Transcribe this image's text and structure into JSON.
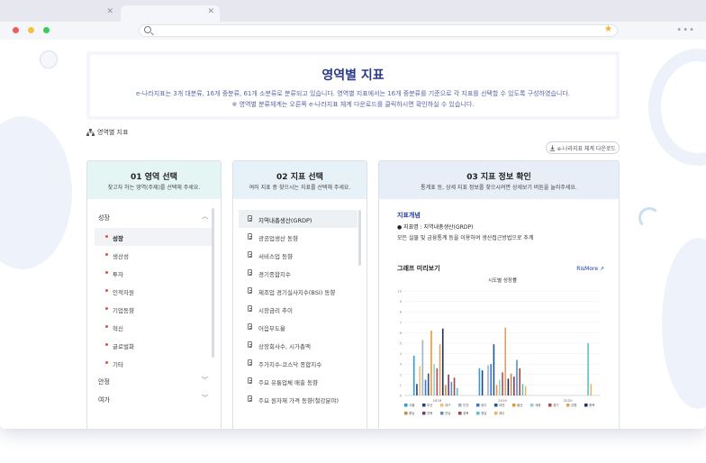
{
  "hero": {
    "title": "영역별 지표",
    "desc_line1": "e-나라지표는 3개 대분류, 16개 중분류, 61개 소분류로 분류되고 있습니다. 영역별 지표에서는 16개 중분류를 기준으로 각 지표를 선택할 수 있도록 구성하였습니다.",
    "desc_line2": "※ 영역별 분류체계는 오른쪽 e-나라지표 체계 다운로드를 클릭하시면 확인하실 수 있습니다."
  },
  "breadcrumb": {
    "label": "영역별 지표"
  },
  "download": {
    "label": "e-나라지표 체계 다운로드"
  },
  "panel1": {
    "title": "01 영역 선택",
    "subtitle": "찾고자 하는 영역(주제)를 선택해 주세요.",
    "categories": [
      {
        "label": "성장",
        "items": [
          "성장",
          "생산성",
          "투자",
          "인적자원",
          "기업동향",
          "혁신",
          "글로벌화",
          "기타"
        ]
      },
      {
        "label": "안정"
      },
      {
        "label": "여가"
      }
    ]
  },
  "panel2": {
    "title": "02 지표 선택",
    "subtitle": "여러 지표 중 찾으시는 지표를 선택해 주세요.",
    "items": [
      "지역내총생산(GRDP)",
      "광공업생산 동향",
      "서비스업 동향",
      "경기종합지수",
      "제조업 경기실사지수(BSI) 동향",
      "시장금리 추이",
      "어음부도율",
      "상장회사수, 시가총액",
      "주가지수-코스닥 종합지수",
      "주요 유통업체 매출 동향",
      "주요 원자재 가격 동향(철강분야)"
    ]
  },
  "panel3": {
    "title": "03 지표 정보 확인",
    "subtitle": "통계표 등, 상세 지표 정보를 찾으시려면 상세보기 버튼을 눌러주세요.",
    "concept_heading": "지표개념",
    "indicator_name": "● 지표명 : 지역내총생산(GRDP)",
    "indicator_desc": "모든 실물 및 금융통계 등을 이용하여 생산접근방법으로 추계",
    "chart_heading": "그래프 미리보기",
    "more_label": "RisMore ↗"
  },
  "chart_data": {
    "type": "bar",
    "title": "시도별 성장률",
    "ylim": [
      0,
      10
    ],
    "yticks": [
      "0",
      "1",
      "2",
      "3",
      "4",
      "5",
      "6",
      "7",
      "8",
      "9",
      "10"
    ],
    "categories": [
      "2018",
      "2019",
      "2020"
    ],
    "series": [
      {
        "name": "서울",
        "color": "#2a9fd8",
        "values": [
          3.8,
          2.6,
          0.0
        ]
      },
      {
        "name": "부산",
        "color": "#2b3f7c",
        "values": [
          1.1,
          2.4,
          0.0
        ]
      },
      {
        "name": "대구",
        "color": "#f0c070",
        "values": [
          2.8,
          0.0,
          0.0
        ]
      },
      {
        "name": "인천",
        "color": "#9fb0c8",
        "values": [
          5.3,
          2.9,
          0.0
        ]
      },
      {
        "name": "광주",
        "color": "#3a7acb",
        "values": [
          1.5,
          3.0,
          0.0
        ]
      },
      {
        "name": "대전",
        "color": "#24568d",
        "values": [
          2.1,
          4.9,
          0.0
        ]
      },
      {
        "name": "울산",
        "color": "#f29530",
        "values": [
          6.2,
          1.0,
          0.0
        ]
      },
      {
        "name": "세종",
        "color": "#8ed4d0",
        "values": [
          3.0,
          1.5,
          0.0
        ]
      },
      {
        "name": "경기",
        "color": "#b04a5a",
        "values": [
          2.6,
          2.2,
          0.0
        ]
      },
      {
        "name": "강원",
        "color": "#e0a060",
        "values": [
          4.9,
          6.5,
          0.0
        ]
      },
      {
        "name": "충북",
        "color": "#223060",
        "values": [
          6.4,
          1.6,
          0.0
        ]
      },
      {
        "name": "충남",
        "color": "#c88b4a",
        "values": [
          1.0,
          2.1,
          0.0
        ]
      },
      {
        "name": "전북",
        "color": "#7a3a6a",
        "values": [
          2.0,
          1.8,
          0.0
        ]
      },
      {
        "name": "전남",
        "color": "#5a8fc0",
        "values": [
          1.3,
          3.4,
          0.0
        ]
      },
      {
        "name": "경북",
        "color": "#9a4a4a",
        "values": [
          1.7,
          2.6,
          0.0
        ]
      },
      {
        "name": "경남",
        "color": "#5ac4c4",
        "values": [
          0.7,
          1.1,
          5.0
        ]
      },
      {
        "name": "제주",
        "color": "#e8b860",
        "values": [
          0.0,
          0.9,
          1.1
        ]
      }
    ]
  }
}
